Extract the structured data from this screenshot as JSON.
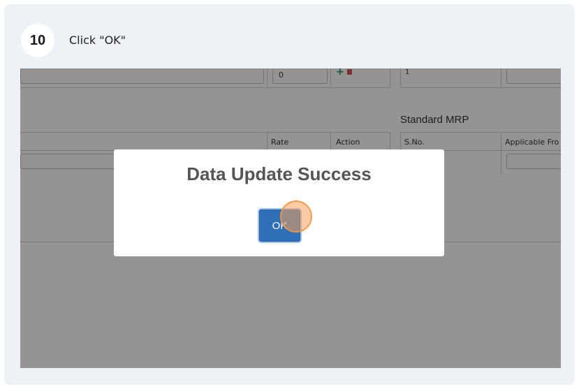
{
  "step": {
    "number": "10",
    "instruction": "Click \"OK\""
  },
  "app": {
    "top_row": {
      "qty_value": "0",
      "sno_value": "1"
    },
    "icons": {
      "add": "plus-icon",
      "delete": "trash-icon"
    },
    "left_table": {
      "headers": {
        "rate": "Rate",
        "action": "Action"
      }
    },
    "standard_mrp": {
      "title": "Standard MRP",
      "headers": {
        "sno": "S.No.",
        "applicable_from": "Applicable Fro"
      }
    }
  },
  "modal": {
    "title": "Data Update Success",
    "ok_label": "OK"
  },
  "colors": {
    "ok_button": "#2f6fb8",
    "click_marker": "#f5a05a"
  }
}
